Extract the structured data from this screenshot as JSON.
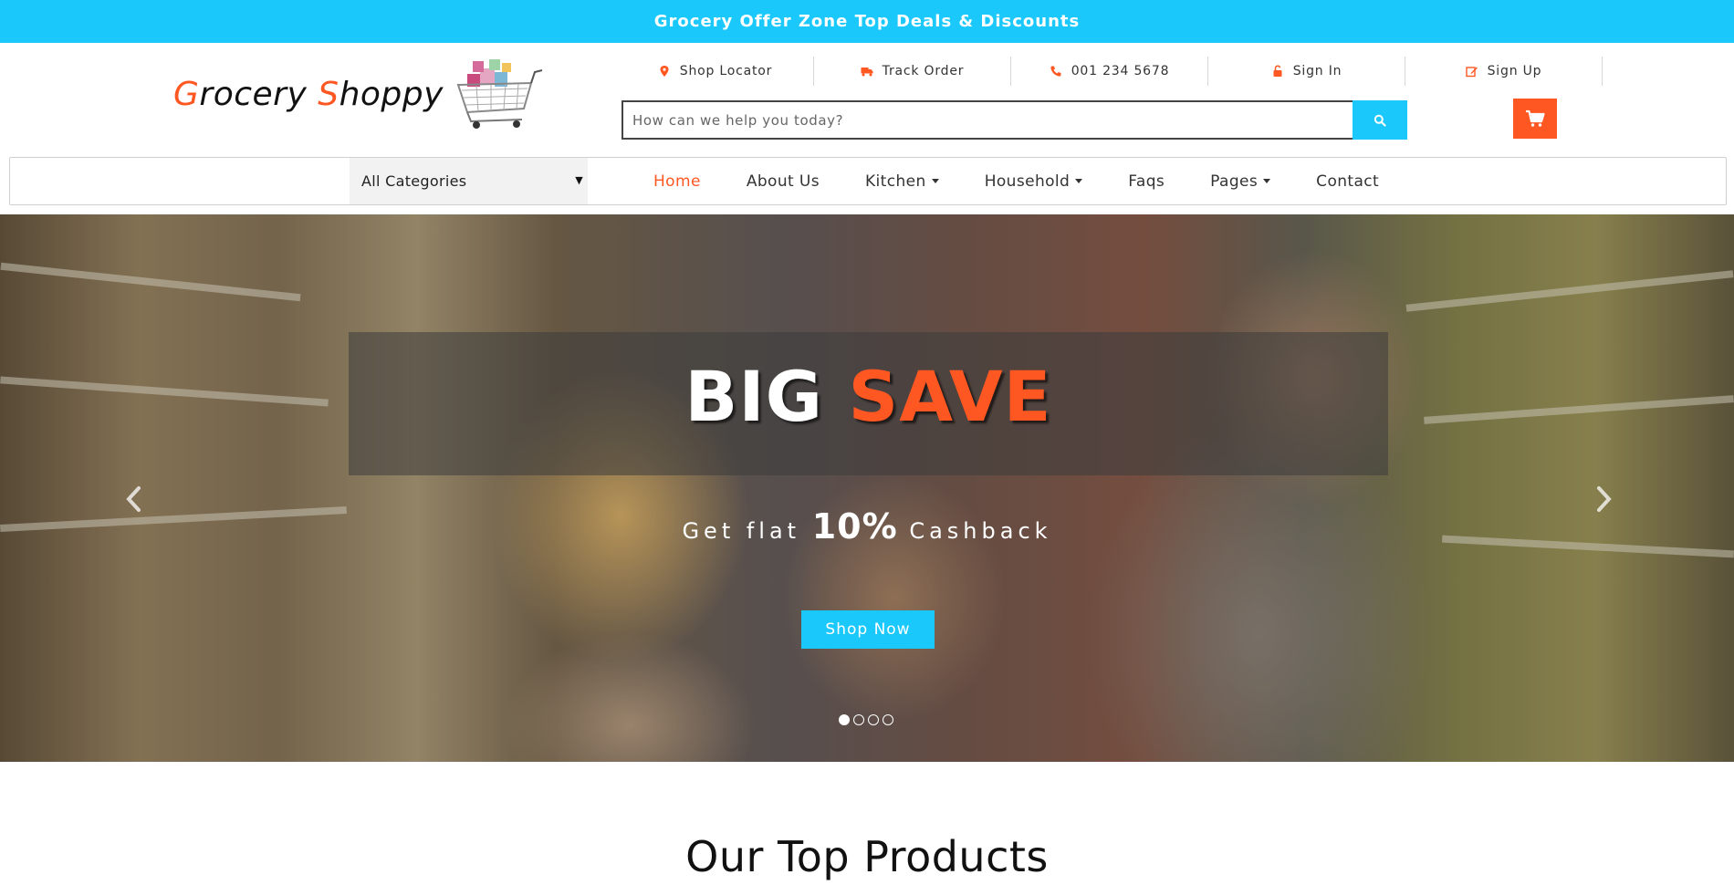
{
  "offer_bar": {
    "text": "Grocery Offer Zone Top Deals & Discounts"
  },
  "logo": {
    "part1_accent": "G",
    "part1": "rocery ",
    "part2_accent": "S",
    "part2": "hoppy"
  },
  "top_links": [
    {
      "label": "Shop Locator",
      "icon": "map-marker-icon"
    },
    {
      "label": "Track Order",
      "icon": "truck-icon"
    },
    {
      "label": "001 234 5678",
      "icon": "phone-icon"
    },
    {
      "label": "Sign In",
      "icon": "unlock-icon"
    },
    {
      "label": "Sign Up",
      "icon": "edit-icon"
    }
  ],
  "search": {
    "placeholder": "How can we help you today?"
  },
  "nav": {
    "category_select": "All Categories",
    "menu": [
      {
        "label": "Home"
      },
      {
        "label": "About Us"
      },
      {
        "label": "Kitchen"
      },
      {
        "label": "Household"
      },
      {
        "label": "Faqs"
      },
      {
        "label": "Pages"
      },
      {
        "label": "Contact"
      }
    ]
  },
  "hero": {
    "title_white": "BIG ",
    "title_accent": "SAVE",
    "sub_before": "Get flat ",
    "sub_big": "10%",
    "sub_after": " Cashback",
    "button": "Shop Now"
  },
  "section": {
    "title": "Our Top Products"
  },
  "colors": {
    "accent": "#ff5722",
    "brand_blue": "#1ac8fb"
  }
}
